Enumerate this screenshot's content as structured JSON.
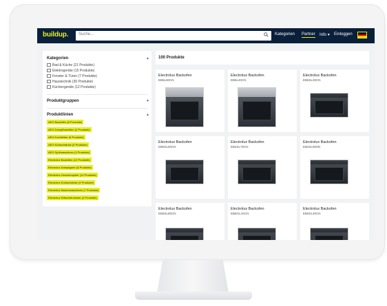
{
  "topbar": {
    "logo": "buildup.",
    "search_placeholder": "Suche...",
    "nav": [
      "Kategorien",
      "Partner",
      "Info",
      "Einloggen"
    ],
    "info_suffix": "▾"
  },
  "sidebar": {
    "categories_title": "Kategorien",
    "categories": [
      "Bad & Küche (21 Produkte)",
      "Elektrogeräte (15 Produkte)",
      "Fenster & Türen (7 Produkte)",
      "Haustechnik (30 Produkte)",
      "Küchengeräte (12 Produkte)"
    ],
    "productgroups_title": "Produktgruppen",
    "productlines_title": "Produktlinien",
    "product_lines": [
      "AEG Backöfen (8 Produkte)",
      "AEG Dampfbacköfen (4 Produkte)",
      "AEG Kochfelder (6 Produkte)",
      "AEG Kühlschränke (5 Produkte)",
      "AEG Spülmaschinen (3 Produkte)",
      "Electrolux Backöfen (12 Produkte)",
      "Electrolux Dampfgarer (8 Produkte)",
      "Electrolux Geschirrspüler (10 Produkte)",
      "Electrolux Kühlschränke (9 Produkte)",
      "Electrolux Waschmaschinen (7 Produkte)",
      "Electrolux Wäschetrockner (4 Produkte)"
    ]
  },
  "main": {
    "count_label": "100 Produkte",
    "products": [
      {
        "brand": "Electrolux Backofen",
        "model": "EB6L80CN"
      },
      {
        "brand": "Electrolux Backofen",
        "model": "EB6L40CN"
      },
      {
        "brand": "Electrolux Backofen",
        "model": "EB6SL30CN"
      },
      {
        "brand": "Electrolux Backofen",
        "model": "EB6SL50CN"
      },
      {
        "brand": "Electrolux Backofen",
        "model": "EB4SL70CN"
      },
      {
        "brand": "Electrolux Backofen",
        "model": "EB4SL80SN"
      },
      {
        "brand": "Electrolux Backofen",
        "model": "EB6SL80CN"
      },
      {
        "brand": "Electrolux Backofen",
        "model": "EB6GL4XCN"
      },
      {
        "brand": "Electrolux Backofen",
        "model": "EB6SL30CN"
      }
    ]
  },
  "colors": {
    "topbar": "#0a1f3a",
    "accent": "#e8f01a",
    "flag_black": "#111111",
    "flag_red": "#dd0000",
    "flag_gold": "#ffce00"
  }
}
